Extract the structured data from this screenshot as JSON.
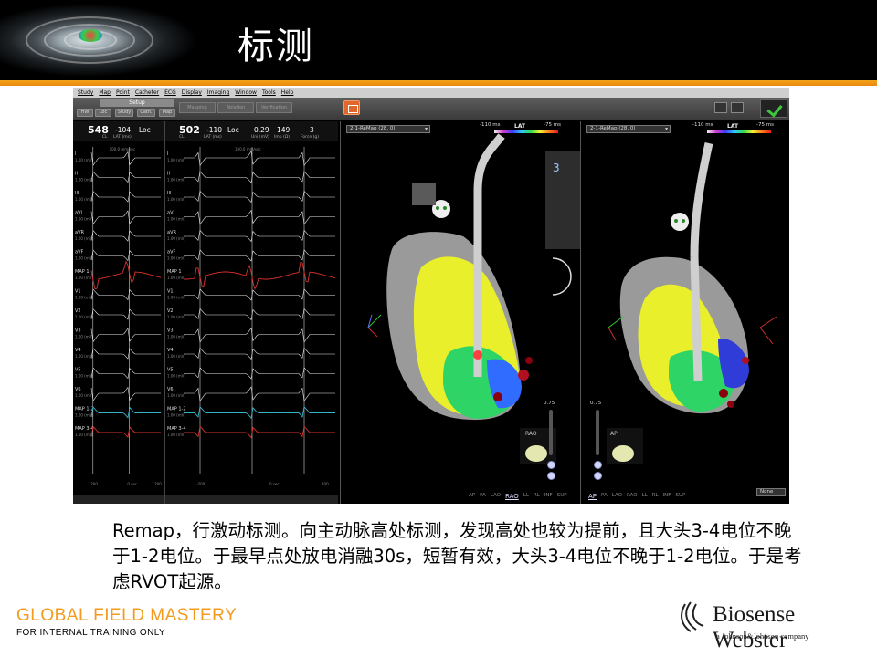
{
  "slide": {
    "title": "标测",
    "body": "Remap，行激动标测。向主动脉高处标测，发现高处也较为提前，且大头3-4电位不晚于1-2电位。于最早点处放电消融30s，短暂有效，大头3-4电位不晚于1-2电位。于是考虑RVOT起源。"
  },
  "footer": {
    "program": "GLOBAL  FIELD  MASTERY",
    "note": "FOR INTERNAL  TRAINING  ONLY",
    "brand": "Biosense Webster",
    "brand_sub": "a Johnson&Johnson company"
  },
  "app": {
    "menu": [
      "Study",
      "Map",
      "Point",
      "Catheter",
      "ECG",
      "Display",
      "Imaging",
      "Window",
      "Tools",
      "Help"
    ],
    "toolbar": {
      "setup": "Setup",
      "buttons": [
        "HW",
        "Loc",
        "Study",
        "Cath.",
        "Map"
      ],
      "wide_buttons": [
        "Mapping",
        "Ablation",
        "Verification"
      ]
    },
    "ecg_left": {
      "cl_value": "548",
      "cl_label": "CL",
      "lat_value": "-104",
      "lat_label": "LAT (ms)",
      "loc": "Loc"
    },
    "ecg_right": {
      "cl_value": "502",
      "cl_label": "CL",
      "lat_value": "-110",
      "lat_label": "LAT (ms)",
      "loc": "Loc",
      "uni_value": "0.29",
      "uni_label": "Uni (mV)",
      "imp_value": "149",
      "imp_label": "Imp (Ω)",
      "force_value": "3",
      "force_label": "Force (g)"
    },
    "channels": [
      "I",
      "II",
      "III",
      "aVL",
      "aVR",
      "aVF",
      "MAP 1",
      "V1",
      "V2",
      "V3",
      "V4",
      "V5",
      "V6",
      "MAP 1-2",
      "MAP 3-4"
    ],
    "scale_label": "1.00 (mV)",
    "speed_label": "100.0 mm/sec",
    "time_axis": [
      "-200",
      "0 sec",
      "200"
    ],
    "map_left": {
      "select": "2-1-ReMap (28, 0)",
      "lat_min": "-110 ms",
      "lat_label": "LAT",
      "lat_max": "-75 ms",
      "slider_value": "0.75",
      "orientation": "RAO",
      "views": [
        "AP",
        "PA",
        "LAO",
        "RAO",
        "LL",
        "RL",
        "INF",
        "SUP"
      ],
      "active_view": "RAO",
      "indicator_value": "3"
    },
    "map_right": {
      "select": "2-1-ReMap (28, 0)",
      "lat_min": "-110 ms",
      "lat_label": "LAT",
      "lat_max": "-75 ms",
      "slider_value": "0.75",
      "orientation": "AP",
      "views": [
        "AP",
        "PA",
        "LAO",
        "RAO",
        "LL",
        "RL",
        "INF",
        "SUP"
      ],
      "active_view": "AP",
      "none_select": "None"
    }
  }
}
